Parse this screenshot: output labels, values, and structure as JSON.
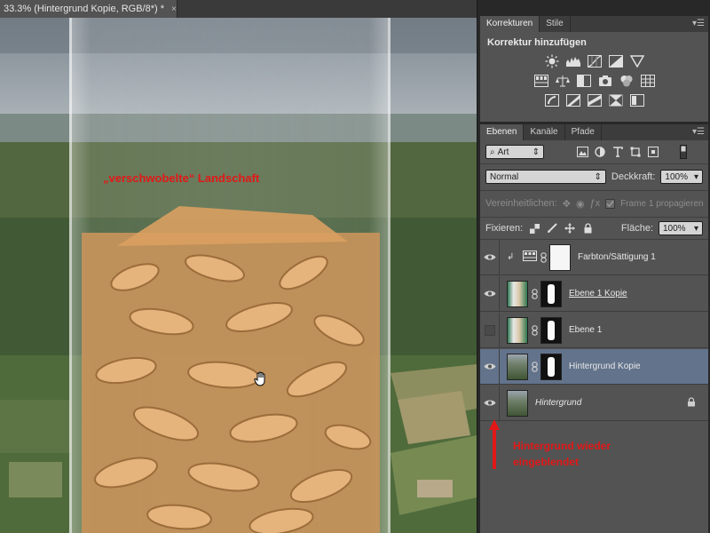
{
  "document": {
    "tab_title": "33.3% (Hintergrund Kopie, RGB/8*) *",
    "close_glyph": "×"
  },
  "canvas": {
    "annotation": "„verschwobelte“ Landschaft"
  },
  "adjustments_panel": {
    "tabs": [
      "Korrekturen",
      "Stile"
    ],
    "active_tab": "Korrekturen",
    "heading": "Korrektur hinzufügen",
    "icon_rows": [
      [
        "brightness-icon",
        "levels-icon",
        "curves-icon",
        "exposure-icon",
        "vibrance-icon"
      ],
      [
        "hue-saturation-icon",
        "color-balance-icon",
        "black-white-icon",
        "photo-filter-icon",
        "channel-mixer-icon",
        "color-lookup-icon"
      ],
      [
        "invert-icon",
        "posterize-icon",
        "threshold-icon",
        "gradient-map-icon",
        "selective-color-icon"
      ]
    ]
  },
  "layers_panel": {
    "tabs": [
      "Ebenen",
      "Kanäle",
      "Pfade"
    ],
    "active_tab": "Ebenen",
    "filter_kind": "Art",
    "blend_mode": "Normal",
    "opacity_label": "Deckkraft:",
    "opacity_value": "100%",
    "unify_label": "Vereinheitlichen:",
    "propagate_label": "Frame 1 propagieren",
    "lock_label": "Fixieren:",
    "fill_label": "Fläche:",
    "fill_value": "100%",
    "layers": [
      {
        "name": "Farbton/Sättigung 1",
        "visible": true,
        "selected": false,
        "type": "adjustment"
      },
      {
        "name": "Ebene 1 Kopie",
        "visible": true,
        "selected": false,
        "type": "masked"
      },
      {
        "name": "Ebene 1",
        "visible": false,
        "selected": false,
        "type": "masked"
      },
      {
        "name": "Hintergrund Kopie",
        "visible": true,
        "selected": true,
        "type": "masked"
      },
      {
        "name": "Hintergrund",
        "visible": true,
        "selected": false,
        "type": "background",
        "locked": true
      }
    ]
  },
  "callout": {
    "line1": "Hintergrund wieder",
    "line2": "eingeblendet"
  },
  "colors": {
    "accent_red": "#e21818",
    "selected_layer": "#63738c",
    "panel_bg": "#535353"
  }
}
